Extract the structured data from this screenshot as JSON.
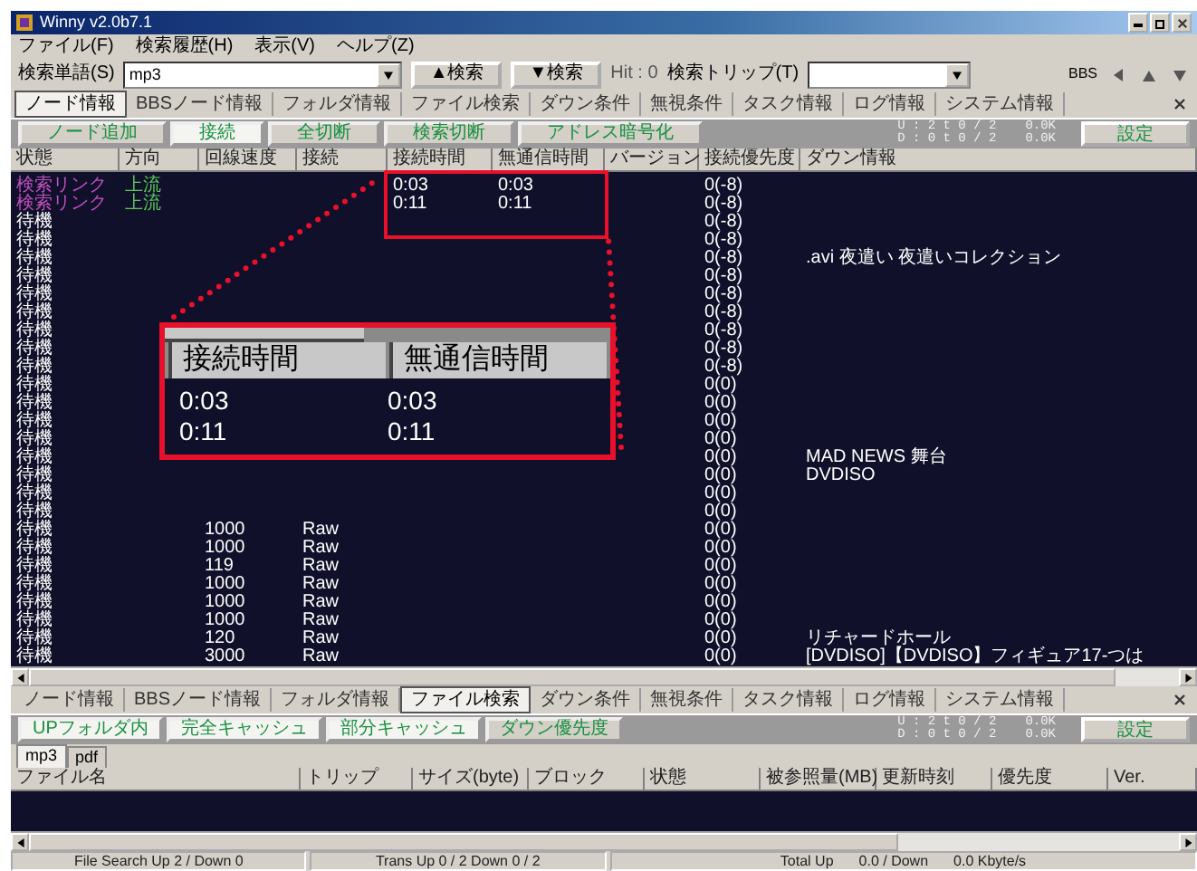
{
  "window": {
    "title": "Winny v2.0b7.1"
  },
  "menu": [
    "ファイル(F)",
    "検索履歴(H)",
    "表示(V)",
    "ヘルプ(Z)"
  ],
  "search_bar": {
    "label": "検索単語(S)",
    "value": "mp3",
    "buttons": [
      "▲検索",
      "▼検索"
    ],
    "hit": "Hit : 0",
    "trip_label": "検索トリップ(T)",
    "bbs_label": "BBS"
  },
  "top_tabs": [
    {
      "label": "ノード情報",
      "selected": true
    },
    {
      "label": "BBSノード情報",
      "selected": false
    },
    {
      "label": "フォルダ情報",
      "selected": false
    },
    {
      "label": "ファイル検索",
      "selected": false
    },
    {
      "label": "ダウン条件",
      "selected": false
    },
    {
      "label": "無視条件",
      "selected": false
    },
    {
      "label": "タスク情報",
      "selected": false
    },
    {
      "label": "ログ情報",
      "selected": false
    },
    {
      "label": "システム情報",
      "selected": false
    }
  ],
  "node_actions": [
    {
      "label": "ノード追加",
      "on": false
    },
    {
      "label": "接続",
      "on": true
    },
    {
      "label": "全切断",
      "on": false
    },
    {
      "label": "検索切断",
      "on": false
    },
    {
      "label": "アドレス暗号化",
      "on": false
    }
  ],
  "node_stats": {
    "up": "U : 2 t 0 / 2",
    "up_rate": "0.0K",
    "down": "D : 0 t 0 / 2",
    "down_rate": "0.0K",
    "settings": "設定"
  },
  "node_table": {
    "columns": [
      "状態",
      "方向",
      "回線速度",
      "接続",
      "接続時間",
      "無通信時間",
      "バージョン",
      "接続優先度",
      "ダウン情報"
    ],
    "rows": [
      {
        "kind": "link",
        "status": "検索リンク",
        "direction": "上流",
        "conn_time": "0:03",
        "idle_time": "0:03",
        "priority": "0(-8)"
      },
      {
        "kind": "link",
        "status": "検索リンク",
        "direction": "上流",
        "conn_time": "0:11",
        "idle_time": "0:11",
        "priority": "0(-8)"
      },
      {
        "kind": "wait",
        "status": "待機",
        "priority": "0(-8)"
      },
      {
        "kind": "wait",
        "status": "待機",
        "priority": "0(-8)"
      },
      {
        "kind": "wait",
        "status": "待機",
        "priority": "0(-8)",
        "download": ".avi 夜遣い 夜遣いコレクション"
      },
      {
        "kind": "wait",
        "status": "待機",
        "priority": "0(-8)"
      },
      {
        "kind": "wait",
        "status": "待機",
        "priority": "0(-8)"
      },
      {
        "kind": "wait",
        "status": "待機",
        "priority": "0(-8)"
      },
      {
        "kind": "wait",
        "status": "待機",
        "priority": "0(-8)"
      },
      {
        "kind": "wait",
        "status": "待機",
        "priority": "0(-8)"
      },
      {
        "kind": "wait",
        "status": "待機",
        "priority": "0(-8)"
      },
      {
        "kind": "wait",
        "status": "待機",
        "priority": "0(0)"
      },
      {
        "kind": "wait",
        "status": "待機",
        "priority": "0(0)"
      },
      {
        "kind": "wait",
        "status": "待機",
        "priority": "0(0)"
      },
      {
        "kind": "wait",
        "status": "待機",
        "priority": "0(0)"
      },
      {
        "kind": "wait",
        "status": "待機",
        "priority": "0(0)",
        "download": "MAD NEWS 舞台"
      },
      {
        "kind": "wait",
        "status": "待機",
        "priority": "0(0)",
        "download": "DVDISO"
      },
      {
        "kind": "wait",
        "status": "待機",
        "priority": "0(0)"
      },
      {
        "kind": "wait",
        "status": "待機",
        "priority": "0(0)"
      },
      {
        "kind": "wait",
        "status": "待機",
        "speed": "1000",
        "conn": "Raw",
        "priority": "0(0)"
      },
      {
        "kind": "wait",
        "status": "待機",
        "speed": "1000",
        "conn": "Raw",
        "priority": "0(0)"
      },
      {
        "kind": "wait",
        "status": "待機",
        "speed": "119",
        "conn": "Raw",
        "priority": "0(0)"
      },
      {
        "kind": "wait",
        "status": "待機",
        "speed": "1000",
        "conn": "Raw",
        "priority": "0(0)"
      },
      {
        "kind": "wait",
        "status": "待機",
        "speed": "1000",
        "conn": "Raw",
        "priority": "0(0)"
      },
      {
        "kind": "wait",
        "status": "待機",
        "speed": "1000",
        "conn": "Raw",
        "priority": "0(0)"
      },
      {
        "kind": "wait",
        "status": "待機",
        "speed": "120",
        "conn": "Raw",
        "priority": "0(0)",
        "download": "リチャードホール"
      },
      {
        "kind": "wait",
        "status": "待機",
        "speed": "3000",
        "conn": "Raw",
        "priority": "0(0)",
        "download": "[DVDISO]【DVDISO】フィギュア17-つは"
      }
    ]
  },
  "callout": {
    "columns": [
      "接続時間",
      "無通信時間"
    ],
    "rows": [
      [
        "0:03",
        "0:03"
      ],
      [
        "0:11",
        "0:11"
      ]
    ]
  },
  "bottom_tabs": [
    {
      "label": "ノード情報",
      "selected": false
    },
    {
      "label": "BBSノード情報",
      "selected": false
    },
    {
      "label": "フォルダ情報",
      "selected": false
    },
    {
      "label": "ファイル検索",
      "selected": true
    },
    {
      "label": "ダウン条件",
      "selected": false
    },
    {
      "label": "無視条件",
      "selected": false
    },
    {
      "label": "タスク情報",
      "selected": false
    },
    {
      "label": "ログ情報",
      "selected": false
    },
    {
      "label": "システム情報",
      "selected": false
    }
  ],
  "file_actions": [
    {
      "label": "UPフォルダ内",
      "on": true
    },
    {
      "label": "完全キャッシュ",
      "on": true
    },
    {
      "label": "部分キャッシュ",
      "on": true
    },
    {
      "label": "ダウン優先度",
      "on": false
    }
  ],
  "file_stats": {
    "up": "U : 2 t 0 / 2",
    "up_rate": "0.0K",
    "down": "D : 0 t 0 / 2",
    "down_rate": "0.0K",
    "settings": "設定"
  },
  "search_tabs": [
    {
      "label": "mp3",
      "selected": true
    },
    {
      "label": "pdf",
      "selected": false
    }
  ],
  "file_table": {
    "columns": [
      "ファイル名",
      "トリップ",
      "サイズ(byte)",
      "ブロック",
      "状態",
      "被参照量(MB)",
      "更新時刻",
      "優先度",
      "Ver."
    ]
  },
  "status_bar": [
    [
      "File Search Up 2 / Down 0"
    ],
    [
      "Trans Up 0 / 2  Down 0 / 2"
    ],
    [
      "Total Up",
      "0.0 / Down",
      "0.0 Kbyte/s"
    ]
  ]
}
